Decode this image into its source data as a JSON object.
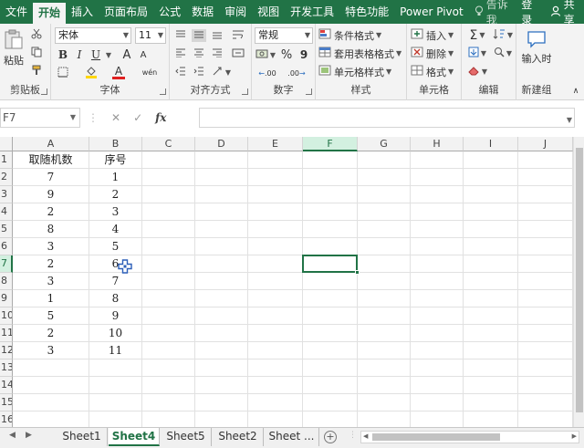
{
  "menu": {
    "items": [
      "文件",
      "开始",
      "插入",
      "页面布局",
      "公式",
      "数据",
      "审阅",
      "视图",
      "开发工具",
      "特色功能",
      "Power Pivot"
    ],
    "active": "开始",
    "tell_me": "告诉我",
    "login": "登录",
    "share": "共享"
  },
  "ribbon": {
    "clipboard": {
      "paste": "粘贴",
      "label": "剪贴板"
    },
    "font": {
      "name": "宋体",
      "size": "11",
      "bold": "B",
      "italic": "I",
      "underline": "U",
      "grow": "A",
      "shrink": "A",
      "font_color": "A",
      "phonetic": "wén",
      "label": "字体"
    },
    "alignment": {
      "label": "对齐方式"
    },
    "number": {
      "format": "常规",
      "percent": "%",
      "comma": "9",
      "dec_inc": ".00",
      "dec_dec": ".00",
      "label": "数字"
    },
    "styles": {
      "conditional": "条件格式",
      "table": "套用表格格式",
      "cell_styles": "单元格样式",
      "label": "样式"
    },
    "cells": {
      "insert": "插入",
      "delete": "删除",
      "format": "格式",
      "label": "单元格"
    },
    "editing": {
      "sum": "Σ",
      "label": "编辑"
    },
    "new_group": {
      "input_time": "输入时",
      "label": "新建组"
    }
  },
  "formula_bar": {
    "name_box": "F7",
    "cancel": "✕",
    "enter": "✓",
    "fx": "fx",
    "value": ""
  },
  "grid": {
    "columns": [
      "A",
      "B",
      "C",
      "D",
      "E",
      "F",
      "G",
      "H",
      "I",
      "J"
    ],
    "rows": [
      "1",
      "2",
      "3",
      "4",
      "5",
      "6",
      "7",
      "8",
      "9",
      "10",
      "11",
      "12",
      "13",
      "14",
      "15",
      "16",
      "17"
    ],
    "selected_cell": "F7",
    "col_a": [
      "取随机数",
      "7",
      "9",
      "2",
      "8",
      "3",
      "2",
      "3",
      "1",
      "5",
      "2",
      "3"
    ],
    "col_b": [
      "序号",
      "1",
      "2",
      "3",
      "4",
      "5",
      "6",
      "7",
      "8",
      "9",
      "10",
      "11"
    ]
  },
  "sheets": {
    "tabs": [
      "Sheet1",
      "Sheet4",
      "Sheet5",
      "Sheet2",
      "Sheet ..."
    ],
    "active": "Sheet4",
    "add": "+"
  },
  "colors": {
    "accent": "#217346",
    "ribbon_bg": "#f3f3f3"
  }
}
